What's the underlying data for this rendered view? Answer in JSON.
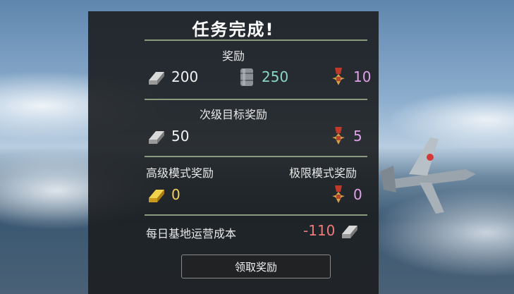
{
  "mission": {
    "title": "任务完成!"
  },
  "rewards": {
    "label": "奖励",
    "items": [
      {
        "icon": "silver-lions-icon",
        "value": "200",
        "color": "#f2f2f2"
      },
      {
        "icon": "fuel-barrel-icon",
        "value": "250",
        "color": "#8ad6c8"
      },
      {
        "icon": "medal-icon",
        "value": "10",
        "color": "#e0a0e8"
      }
    ]
  },
  "secondary": {
    "label": "次级目标奖励",
    "items": [
      {
        "icon": "silver-lions-icon",
        "value": "50"
      },
      {
        "icon": "medal-icon",
        "value": "5"
      }
    ]
  },
  "advanced": {
    "label": "高级模式奖励",
    "item": {
      "icon": "gold-lions-icon",
      "value": "0"
    }
  },
  "extreme": {
    "label": "极限模式奖励",
    "item": {
      "icon": "medal-icon",
      "value": "0"
    }
  },
  "base_cost": {
    "label": "每日基地运营成本",
    "value": "-110",
    "icon": "silver-lions-icon"
  },
  "claim_button": {
    "label": "领取奖励"
  }
}
